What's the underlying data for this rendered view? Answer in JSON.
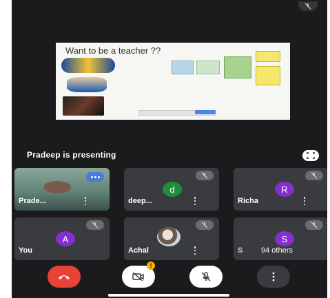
{
  "presentation": {
    "slide_title": "Want to be a teacher ??",
    "presenting_label": "Pradeep is presenting"
  },
  "participants": [
    {
      "name": "Prade...",
      "muted": false,
      "speaking": true,
      "avatar": "video"
    },
    {
      "name": "deep...",
      "muted": true,
      "avatar_letter": "d",
      "avatar_color": "#1e8e3e"
    },
    {
      "name": "Richa",
      "muted": true,
      "avatar_letter": "R",
      "avatar_color": "#8430ce"
    },
    {
      "name": "You",
      "muted": true,
      "avatar_letter": "A",
      "avatar_color": "#8430ce"
    },
    {
      "name": "Achal",
      "muted": true,
      "avatar": "photo"
    },
    {
      "name": "S",
      "muted": true,
      "avatar_letter": "S",
      "avatar_color": "#8430ce",
      "others_label": "94 others"
    }
  ],
  "controls": {
    "camera_badge": "!",
    "end_call_color": "#e84337"
  },
  "icons": [
    "mic-off-icon",
    "fullscreen-icon",
    "more-vert-icon",
    "end-call-icon",
    "camera-off-icon"
  ]
}
